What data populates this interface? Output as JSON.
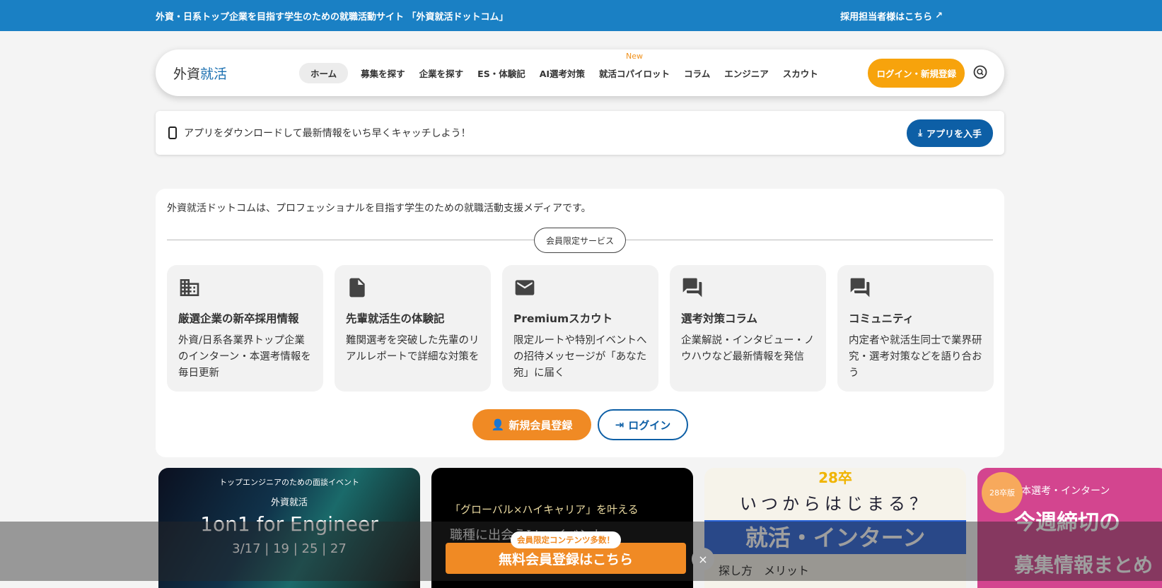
{
  "topbar": {
    "tagline": "外資・日系トップ企業を目指す学生のための就職活動サイト 「外資就活ドットコム」",
    "recruiter_link": "採用担当者様はこちら"
  },
  "nav": {
    "logo_black": "外資",
    "logo_blue": "就活",
    "items": [
      {
        "label": "ホーム"
      },
      {
        "label": "募集を探す"
      },
      {
        "label": "企業を探す"
      },
      {
        "label": "ES・体験記"
      },
      {
        "label": "AI選考対策"
      },
      {
        "label": "就活コパイロット",
        "badge": "New"
      },
      {
        "label": "コラム"
      },
      {
        "label": "エンジニア"
      },
      {
        "label": "スカウト"
      }
    ],
    "login": "ログイン・新規登録"
  },
  "app_bar": {
    "text": "アプリをダウンロードして最新情報をいち早くキャッチしよう！",
    "button": "アプリを入手"
  },
  "main": {
    "intro": "外資就活ドットコムは、プロフェッショナルを目指す学生のための就職活動支援メディアです。",
    "section_label": "会員限定サービス",
    "cards": [
      {
        "title": "厳選企業の新卒採用情報",
        "desc": "外資/日系各業界トップ企業のインターン・本選考情報を毎日更新",
        "icon": "building-icon"
      },
      {
        "title": "先輩就活生の体験記",
        "desc": "難関選考を突破した先輩のリアルレポートで詳細な対策を",
        "icon": "document-icon"
      },
      {
        "title": "Premiumスカウト",
        "desc": "限定ルートや特別イベントへの招待メッセージが「あなた宛」に届く",
        "icon": "mail-icon"
      },
      {
        "title": "選考対策コラム",
        "desc": "企業解説・インタビュー・ノウハウなど最新情報を発信",
        "icon": "chat-icon"
      },
      {
        "title": "コミュニティ",
        "desc": "内定者や就活生同士で業界研究・選考対策などを語り合おう",
        "icon": "forum-icon"
      }
    ],
    "register": "新規会員登録",
    "login": "ログイン"
  },
  "banners": [
    {
      "line1": "トップエンジニアのための面談イベント",
      "line2": "外資就活",
      "line3": "1on1 for Engineer",
      "line4": "3/17 | 19 | 25 | 27"
    },
    {
      "line1": "「グローバル×ハイキャリア」を叶える",
      "line2": "職種に出会うLiveイベント"
    },
    {
      "line1": "28卒",
      "line2": "いつからはじまる？",
      "line3": "就活・インターン",
      "line4": "探し方　メリット"
    },
    {
      "line1": "28卒版",
      "line2": "本選考・インターン",
      "line3": "今週締切の",
      "line4": "募集情報まとめ"
    }
  ],
  "overlay": {
    "badge": "会員限定コンテンツ多数！",
    "cta": "無料会員登録はこちら",
    "close": "×"
  }
}
